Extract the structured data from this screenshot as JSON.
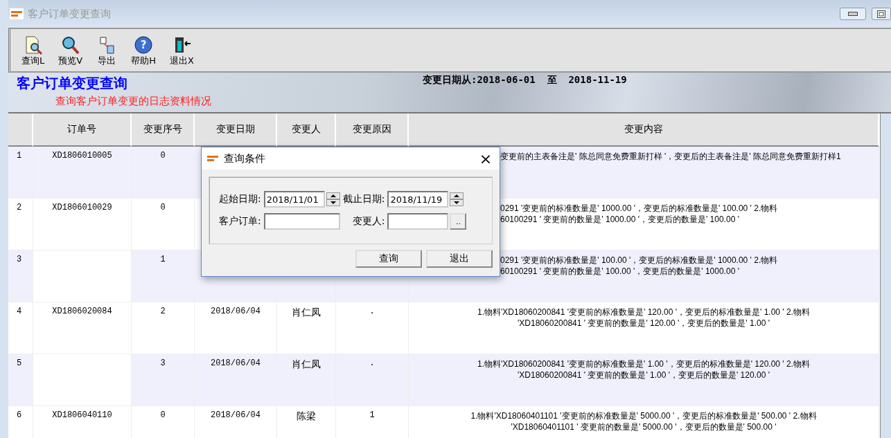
{
  "window": {
    "title": "客户订单变更查询"
  },
  "toolbar": [
    {
      "label": "查询L"
    },
    {
      "label": "预览V"
    },
    {
      "label": "导出"
    },
    {
      "label": "帮助H",
      "icon_text": "?"
    },
    {
      "label": "退出X"
    }
  ],
  "banner": {
    "title": "客户订单变更查询",
    "subtitle": "查询客户订单变更的日志资料情况",
    "date_range": "变更日期从:2018-06-01  至  2018-11-19"
  },
  "table": {
    "columns": [
      "订单号",
      "变更序号",
      "变更日期",
      "变更人",
      "变更原因",
      "变更内容"
    ],
    "rows": [
      {
        "no": "1",
        "order_no": "XD1806010005",
        "seq": "0",
        "highlighted": true,
        "content": "变更前的主表备注是' 陈总同意免费重新打样 '，变更后的主表备注是' 陈总同意免费重新打样1"
      },
      {
        "no": "2",
        "order_no": "XD1806010029",
        "seq": "0",
        "highlighted": false,
        "content": "0291 '变更前的标准数量是' 1000.00 '，变更后的标准数量是' 100.00 ' 2.物料\n60100291 ' 变更前的数量是' 1000.00 '，变更后的数量是' 100.00 '"
      },
      {
        "no": "3",
        "seq": "1",
        "highlighted": true,
        "content": "0291 '变更前的标准数量是' 100.00 '，变更后的标准数量是' 1000.00 ' 2.物料\n60100291 ' 变更前的数量是' 100.00 '，变更后的数量是' 1000.00 '"
      },
      {
        "no": "4",
        "order_no": "XD1806020084",
        "seq": "2",
        "date": "2018/06/04",
        "person": "肖仁凤",
        "reason": ".",
        "highlighted": false,
        "content": "1.物料'XD18060200841 '变更前的标准数量是' 120.00 '，变更后的标准数量是' 1.00 ' 2.物料\n'XD18060200841 ' 变更前的数量是' 120.00 '，变更后的数量是' 1.00 '"
      },
      {
        "no": "5",
        "seq": "3",
        "date": "2018/06/04",
        "person": "肖仁凤",
        "reason": ".",
        "highlighted": true,
        "content": "1.物料'XD18060200841 '变更前的标准数量是' 1.00 '，变更后的标准数量是' 120.00 ' 2.物料\n'XD18060200841 ' 变更前的数量是' 1.00 '，变更后的数量是' 120.00 '"
      },
      {
        "no": "6",
        "order_no": "XD1806040110",
        "seq": "0",
        "date": "2018/06/04",
        "person": "陈梁",
        "reason": "1",
        "highlighted": false,
        "content": "1.物料'XD18060401101 '变更前的标准数量是' 5000.00 '，变更后的标准数量是' 500.00 ' 2.物料\n'XD18060401101 ' 变更前的数量是' 5000.00 '，变更后的数量是' 500.00 '"
      }
    ]
  },
  "dialog": {
    "title": "查询条件",
    "close": "×",
    "fields": [
      {
        "label": "起始日期:",
        "value": "2018/11/01",
        "kind": "spin"
      },
      {
        "label": "截止日期:",
        "value": "2018/11/19",
        "kind": "spin"
      },
      {
        "label": "客户订单:",
        "kind": "text"
      },
      {
        "label": "变更人:",
        "kind": "lookup",
        "button": ".."
      }
    ],
    "buttons": [
      "查询",
      "退出"
    ]
  }
}
